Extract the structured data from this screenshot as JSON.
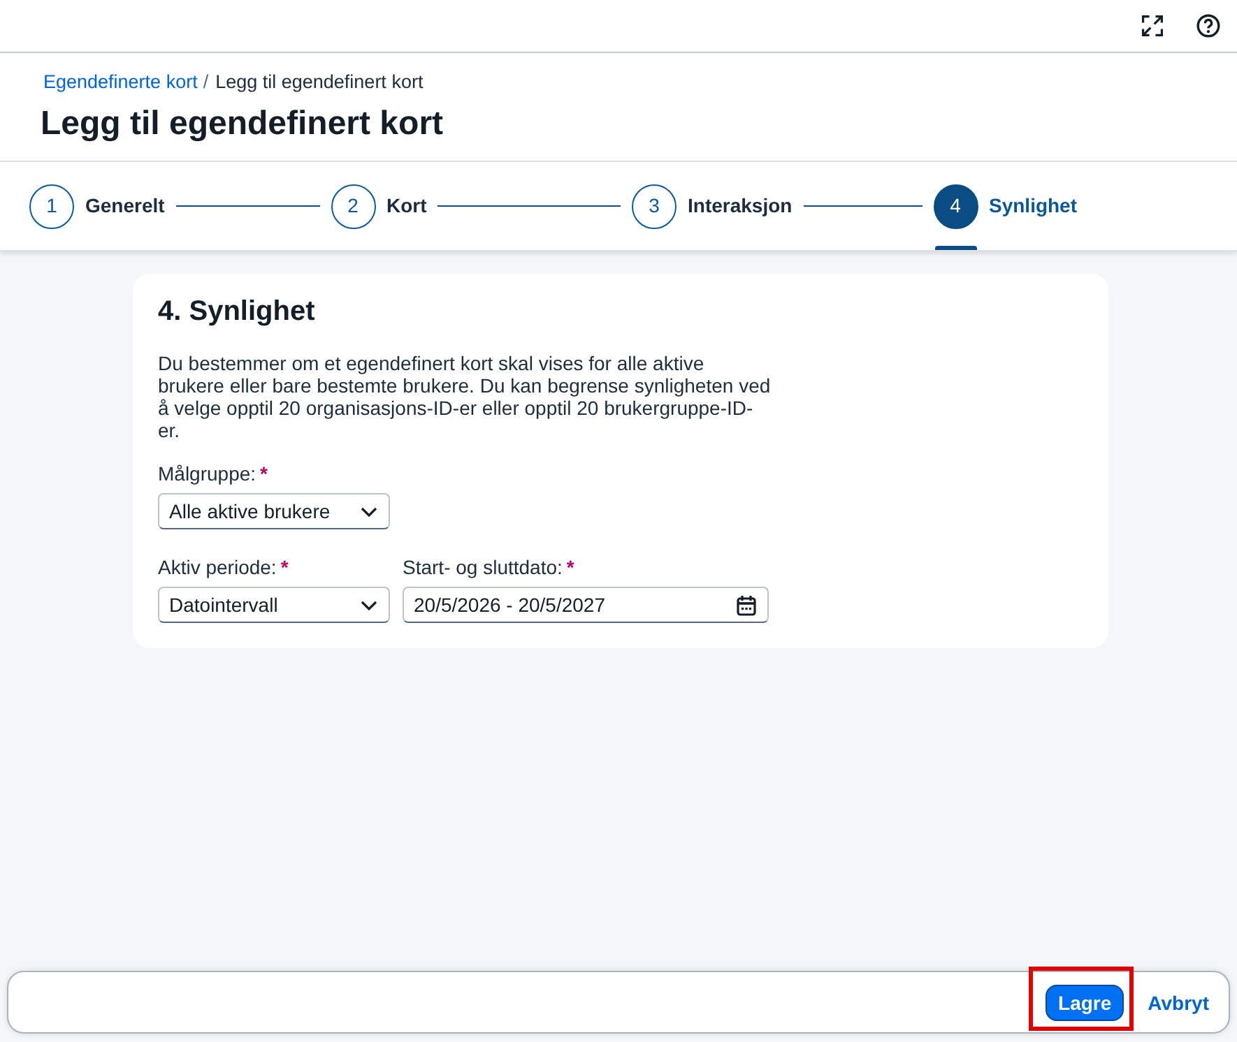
{
  "header": {
    "breadcrumbs": [
      {
        "label": "Egendefinerte kort",
        "kind": "link",
        "separator": "/"
      },
      {
        "label": "Legg til egendefinert kort",
        "kind": "current"
      }
    ],
    "title": "Legg til egendefinert kort"
  },
  "wizard": {
    "steps": [
      {
        "number": "1",
        "label": "Generelt",
        "selected": false
      },
      {
        "number": "2",
        "label": "Kort",
        "selected": false
      },
      {
        "number": "3",
        "label": "Interaksjon",
        "selected": false
      },
      {
        "number": "4",
        "label": "Synlighet",
        "selected": true
      }
    ]
  },
  "section": {
    "title": "4. Synlighet",
    "description": "Du bestemmer om et egendefinert kort skal vises for alle aktive brukere eller bare bestemte brukere. Du kan begrense synligheten ved å velge opptil 20 organisasjons-ID-er eller opptil 20 brukergruppe-ID-er.",
    "rows": [
      [
        {
          "label": "Målgruppe:",
          "required_mark": "*",
          "kind": "select",
          "value": "Alle aktive brukere"
        }
      ],
      [
        {
          "label": "Aktiv periode:",
          "required_mark": "*",
          "kind": "select",
          "value": "Datointervall"
        },
        {
          "label": "Start- og sluttdato:",
          "required_mark": "*",
          "kind": "date_range",
          "value": "20/5/2026 - 20/5/2027"
        }
      ]
    ]
  },
  "footer": {
    "buttons": [
      {
        "label": "Lagre",
        "kind": "primary",
        "highlighted": true
      },
      {
        "label": "Avbryt",
        "kind": "transparent",
        "highlighted": false
      }
    ]
  }
}
